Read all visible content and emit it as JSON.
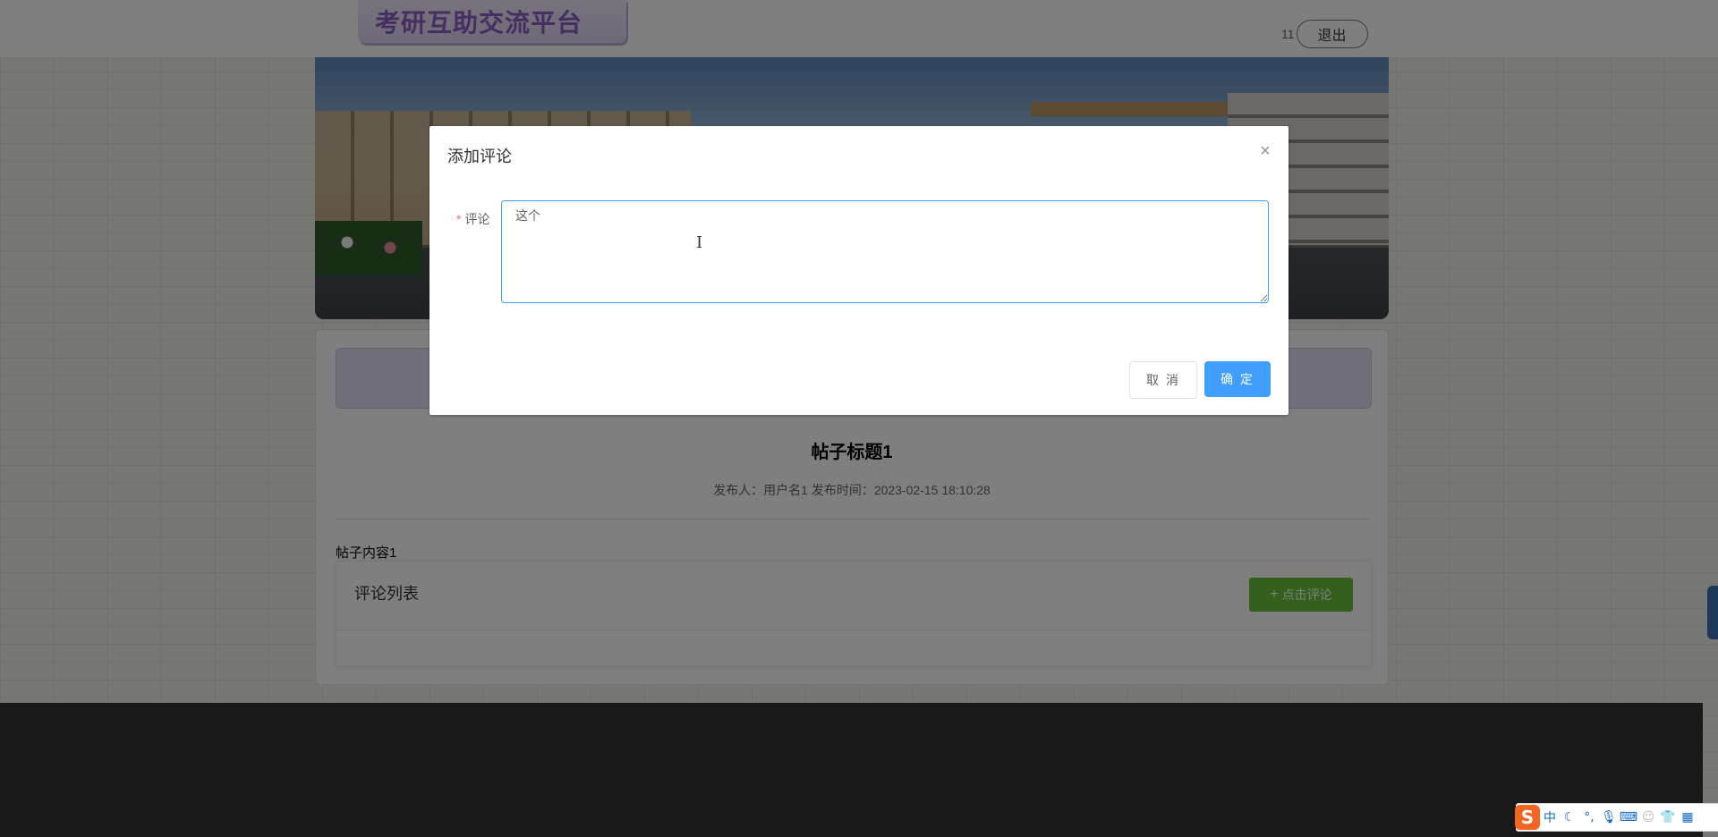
{
  "header": {
    "logo_text": "考研互助交流平台",
    "username": "11",
    "logout_label": "退出"
  },
  "post": {
    "title": "帖子标题1",
    "meta": "发布人：用户名1  发布时间：2023-02-15 18:10:28",
    "content": "帖子内容1"
  },
  "comments": {
    "title": "评论列表",
    "add_button_label": "点击评论",
    "add_button_icon": "plus-icon"
  },
  "dialog": {
    "title": "添加评论",
    "close_icon": "close-icon",
    "field_required_mark": "*",
    "field_label": "评论",
    "field_value": "这个",
    "cancel_label": "取 消",
    "confirm_label": "确 定"
  },
  "ime": {
    "logo": "S",
    "mode": "中",
    "icons": [
      "moon-icon",
      "punctuation-icon",
      "microphone-icon",
      "keyboard-icon",
      "user-icon",
      "shirt-icon",
      "grid-icon"
    ]
  },
  "colors": {
    "primary": "#409eff",
    "success": "#67c23a",
    "logo": "#8a5cc4",
    "footer": "#333333"
  }
}
